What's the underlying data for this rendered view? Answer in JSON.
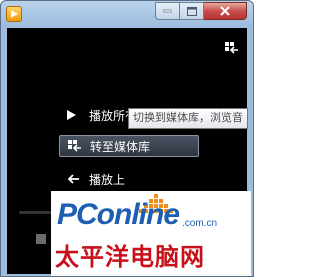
{
  "window": {
    "controls": {
      "minimize": "—",
      "maximize": "☐",
      "close": "✕"
    }
  },
  "menu": {
    "items": [
      {
        "label": "播放所有音乐",
        "icon": "play-icon"
      },
      {
        "label": "转至媒体库",
        "icon": "library-switch-icon"
      },
      {
        "label": "播放上",
        "icon": "back-arrow-icon"
      }
    ]
  },
  "tooltip": {
    "text": "切换到媒体库，浏览音"
  },
  "watermark": {
    "brand": "PConline",
    "domain": ".com.cn",
    "chinese": "太平洋电脑网"
  },
  "colors": {
    "brand_blue": "#1f5fb3",
    "brand_red": "#c8101a",
    "close_red": "#c75050"
  }
}
